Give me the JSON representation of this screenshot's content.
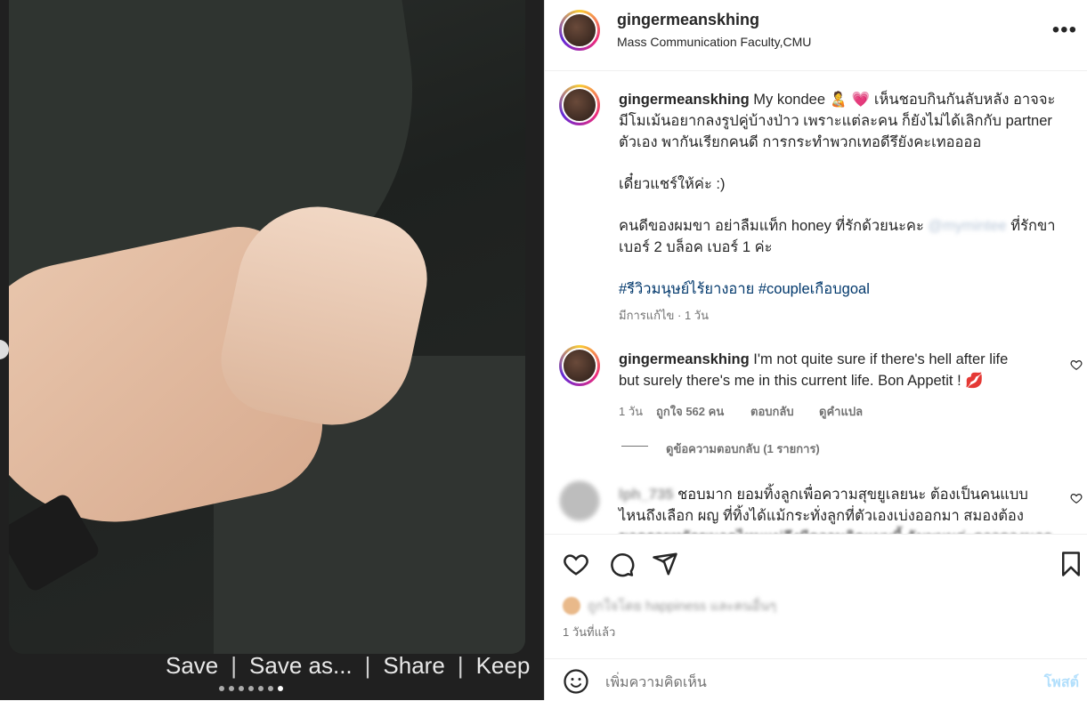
{
  "media": {
    "controls": [
      "Save",
      "Save as...",
      "Share",
      "Keep"
    ],
    "carousel_total": 7,
    "carousel_active": 7
  },
  "header": {
    "username": "gingermeanskhing",
    "location": "Mass Communication Faculty,CMU",
    "more_icon": "more-horizontal-icon"
  },
  "caption": {
    "username": "gingermeanskhing",
    "line1_rest": "My kondee 🧑‍🍼 💗 เห็นชอบกินกันลับหลัง อาจจะ",
    "line2": "มีโมเม้นอยากลงรูปคู่บ้างป่าว เพราะแต่ละคน ก็ยังไม่ได้เลิกกับ partner",
    "line3": "ตัวเอง พากันเรียกคนดี การกระทำพวกเทอดีรึยังคะเทออออ",
    "line4": "เดี๋ยวแชร์ให้ค่ะ :)",
    "line5_a": "คนดีของผมขา อย่าลืมแท็ก honey ที่รักด้วยนะคะ",
    "line5_mention": "@mymintee",
    "line5_b": "ที่รักขา",
    "line6": "เบอร์ 2 บล็อค เบอร์ 1 ค่ะ",
    "hashtags": "#รีวิวมนุษย์ไร้ยางอาย #coupleเกือบgoal",
    "meta": "มีการแก้ไข · 1 วัน"
  },
  "comment1": {
    "username": "gingermeanskhing",
    "text_line1": "I'm not quite sure if there's hell after life",
    "text_line2": "but surely there's me in this current life. Bon Appetit ! 💋",
    "time": "1 วัน",
    "likes": "ถูกใจ 562 คน",
    "reply": "ตอบกลับ",
    "translate": "ดูคำแปล",
    "view_replies": "ดูข้อความตอบกลับ (1 รายการ)"
  },
  "comment2": {
    "username": "lph_735",
    "line1": "ชอบมาก ยอมทิ้งลูกเพื่อความสุขยูเลยนะ ต้องเป็นคนแบบ",
    "line2": "ไหนถึงเลือก ผญ ที่ทิ้งได้แม้กระทั่งลูกที่ตัวเองเบ่งออกมา สมองต้อง",
    "line3": "ขาดรอยหยักขนาดไหนแม่ถึงมีความคิดแบบนี้ ฉันพนมค่ะดาวดวงนอก"
  },
  "actions": {
    "liked_by": "ถูกใจโดย happiness และคนอื่นๆ",
    "ago": "1 วันที่แล้ว"
  },
  "comment_box": {
    "placeholder": "เพิ่มความคิดเห็น",
    "post": "โพสต์"
  }
}
